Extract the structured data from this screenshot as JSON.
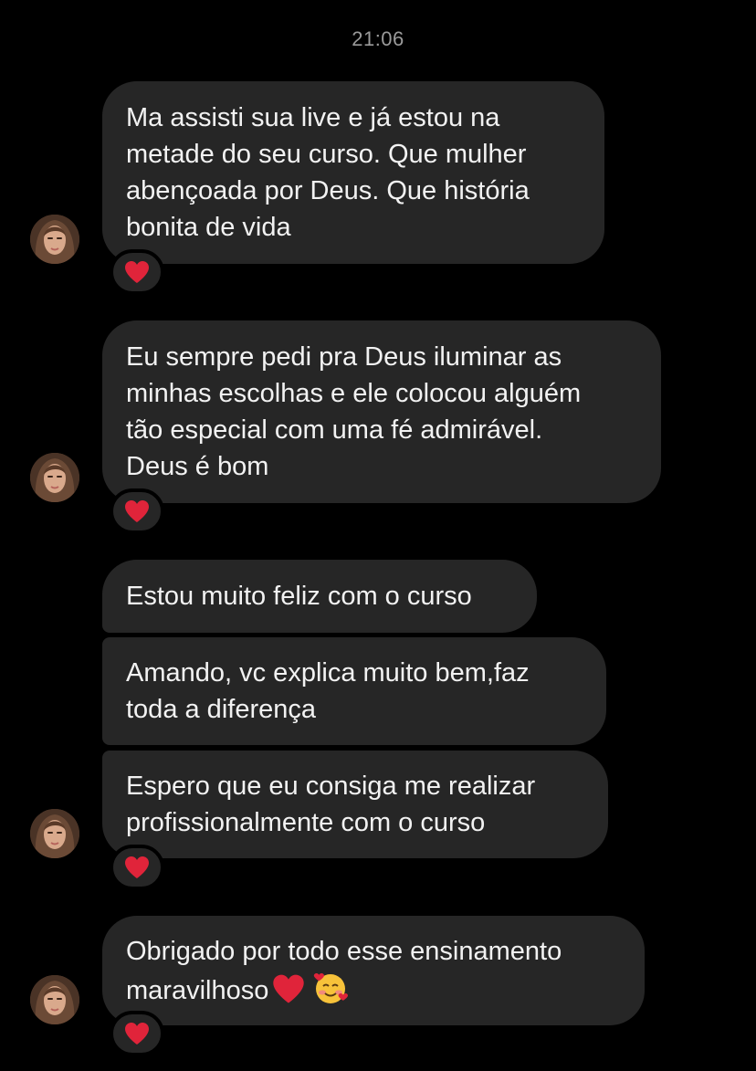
{
  "chat": {
    "timestamp": "21:06",
    "messages": [
      {
        "text": "Ma assisti sua live e já estou na\nmetade do seu curso. Que mulher\nabençoada por Deus. Que história\nbonita de vida",
        "reaction": "heart-icon"
      },
      {
        "text": "Eu sempre pedi pra Deus iluminar as\nminhas escolhas e ele colocou alguém\ntão especial com uma fé admirável.\nDeus é bom",
        "reaction": "heart-icon"
      },
      {
        "text": "Estou muito feliz com o curso"
      },
      {
        "text": "Amando, vc explica muito bem,faz\ntoda a diferença"
      },
      {
        "text": "Espero que eu consiga me realizar\nprofissionalmente com o curso",
        "reaction": "heart-icon"
      },
      {
        "text": "Obrigado por todo esse ensinamento\nmaravilhoso",
        "trailing_emoji": [
          "red-heart-emoji",
          "smiling-face-with-hearts-emoji"
        ],
        "reaction": "heart-icon"
      }
    ]
  },
  "theme": {
    "background": "#000000",
    "bubble": "#262626",
    "text": "#f2f2f2",
    "timestamp": "#9a9a9a",
    "heart": "#e0243a"
  }
}
